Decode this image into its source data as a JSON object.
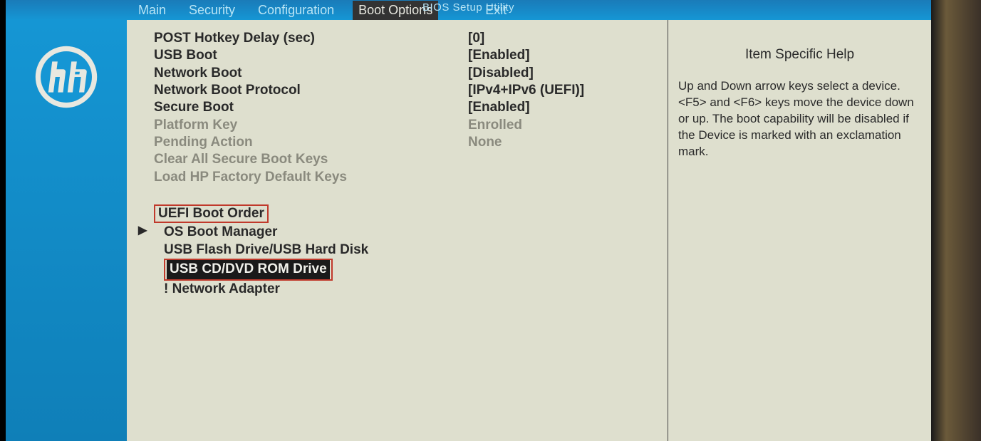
{
  "utility_title": "BIOS Setup Utility",
  "tabs": {
    "main": "Main",
    "security": "Security",
    "configuration": "Configuration",
    "boot_options": "Boot Options",
    "exit": "Exit"
  },
  "settings": [
    {
      "label": "POST Hotkey Delay (sec)",
      "value": "[0]",
      "dimmed": false
    },
    {
      "label": "USB Boot",
      "value": "[Enabled]",
      "dimmed": false
    },
    {
      "label": "Network Boot",
      "value": "[Disabled]",
      "dimmed": false
    },
    {
      "label": "Network Boot Protocol",
      "value": "[IPv4+IPv6 (UEFI)]",
      "dimmed": false
    },
    {
      "label": "Secure Boot",
      "value": "[Enabled]",
      "dimmed": false
    },
    {
      "label": "Platform Key",
      "value": "Enrolled",
      "dimmed": true
    },
    {
      "label": "Pending Action",
      "value": "None",
      "dimmed": true
    },
    {
      "label": "Clear All Secure Boot Keys",
      "value": "",
      "dimmed": true
    },
    {
      "label": "Load HP Factory Default Keys",
      "value": "",
      "dimmed": true
    }
  ],
  "boot_section": {
    "header": "UEFI Boot Order",
    "items": [
      {
        "label": "OS Boot Manager",
        "marker": "▶",
        "highlighted": false
      },
      {
        "label": "USB Flash Drive/USB Hard Disk",
        "marker": "",
        "highlighted": false
      },
      {
        "label": "USB CD/DVD ROM Drive",
        "marker": "",
        "highlighted": true
      },
      {
        "label": "! Network Adapter",
        "marker": "",
        "highlighted": false
      }
    ]
  },
  "help": {
    "title": "Item Specific Help",
    "body": "Up and Down arrow keys select a device. <F5> and <F6> keys move the device down or up.\nThe boot capability will be disabled if the Device is marked with an exclamation mark."
  }
}
